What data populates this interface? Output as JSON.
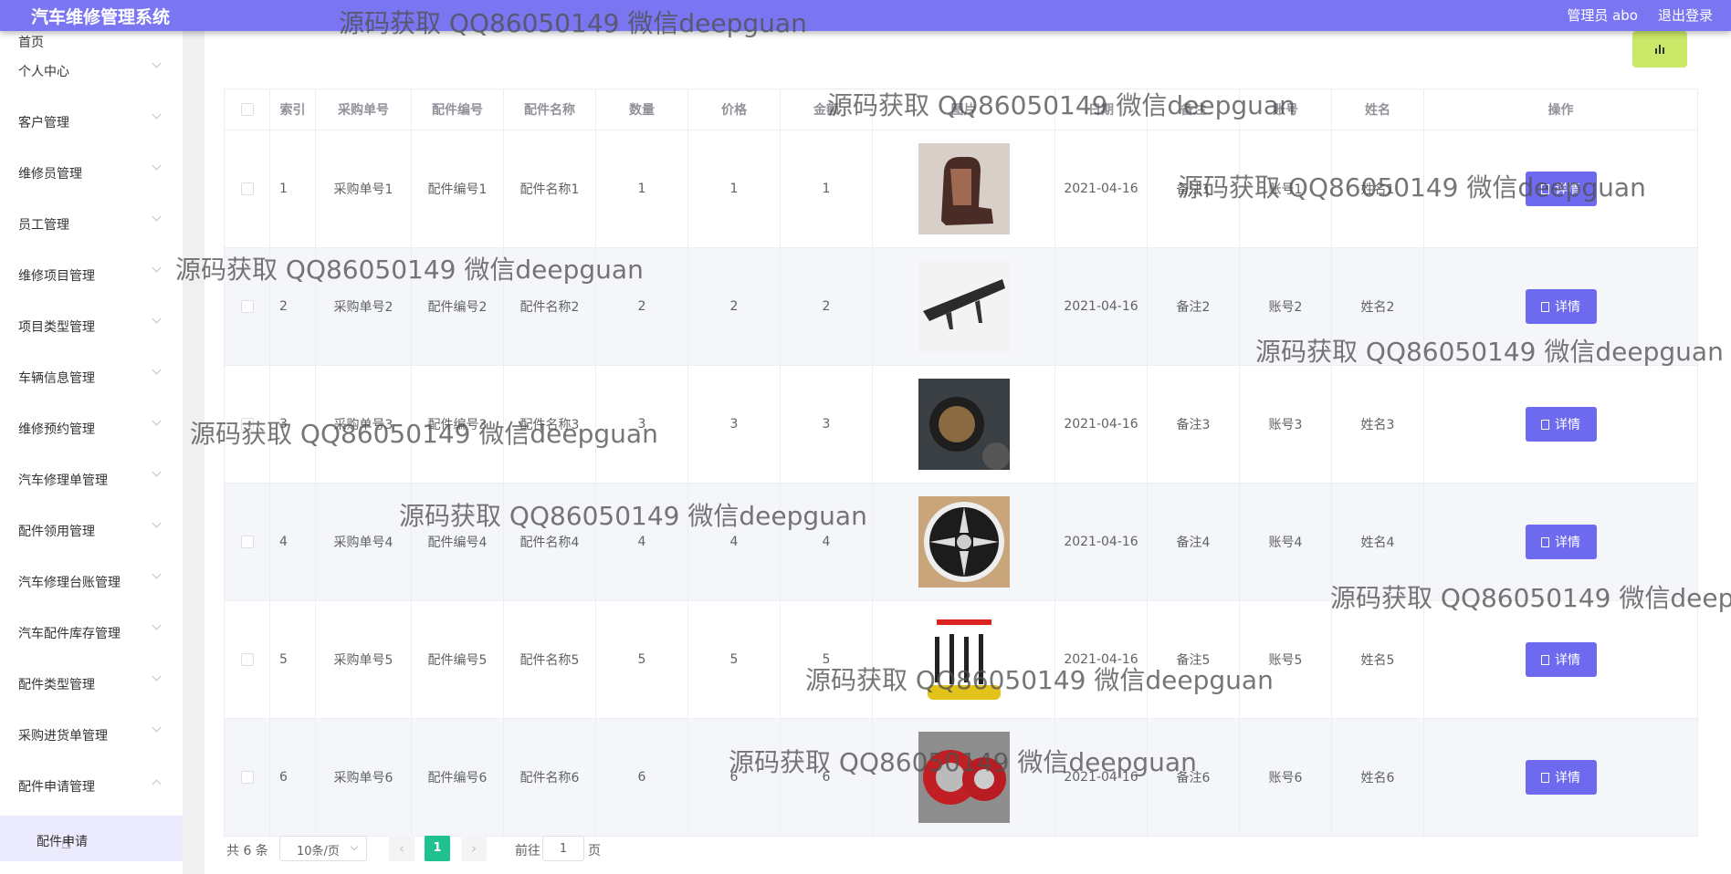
{
  "header": {
    "title": "汽车维修管理系统",
    "user": "管理员 abo",
    "logout": "退出登录"
  },
  "sidebar": {
    "items": [
      {
        "label": "首页"
      },
      {
        "label": "个人中心"
      },
      {
        "label": "客户管理"
      },
      {
        "label": "维修员管理"
      },
      {
        "label": "员工管理"
      },
      {
        "label": "维修项目管理"
      },
      {
        "label": "项目类型管理"
      },
      {
        "label": "车辆信息管理"
      },
      {
        "label": "维修预约管理"
      },
      {
        "label": "汽车修理单管理"
      },
      {
        "label": "配件领用管理"
      },
      {
        "label": "汽车修理台账管理"
      },
      {
        "label": "汽车配件库存管理"
      },
      {
        "label": "配件类型管理"
      },
      {
        "label": "采购进货单管理"
      },
      {
        "label": "配件申请管理"
      }
    ],
    "submenu_label": "配件申请"
  },
  "table": {
    "columns": [
      "索引",
      "采购单号",
      "配件编号",
      "配件名称",
      "数量",
      "价格",
      "金额",
      "图片",
      "日期",
      "备注",
      "账号",
      "姓名",
      "操作"
    ],
    "rows": [
      {
        "index": "1",
        "order_no": "采购单号1",
        "part_no": "配件编号1",
        "part_name": "配件名称1",
        "qty": "1",
        "price": "1",
        "amount": "1",
        "date": "2021-04-16",
        "note": "备注1",
        "account": "账号1",
        "name": "姓名1"
      },
      {
        "index": "2",
        "order_no": "采购单号2",
        "part_no": "配件编号2",
        "part_name": "配件名称2",
        "qty": "2",
        "price": "2",
        "amount": "2",
        "date": "2021-04-16",
        "note": "备注2",
        "account": "账号2",
        "name": "姓名2"
      },
      {
        "index": "3",
        "order_no": "采购单号3",
        "part_no": "配件编号3",
        "part_name": "配件名称3",
        "qty": "3",
        "price": "3",
        "amount": "3",
        "date": "2021-04-16",
        "note": "备注3",
        "account": "账号3",
        "name": "姓名3"
      },
      {
        "index": "4",
        "order_no": "采购单号4",
        "part_no": "配件编号4",
        "part_name": "配件名称4",
        "qty": "4",
        "price": "4",
        "amount": "4",
        "date": "2021-04-16",
        "note": "备注4",
        "account": "账号4",
        "name": "姓名4"
      },
      {
        "index": "5",
        "order_no": "采购单号5",
        "part_no": "配件编号5",
        "part_name": "配件名称5",
        "qty": "5",
        "price": "5",
        "amount": "5",
        "date": "2021-04-16",
        "note": "备注5",
        "account": "账号5",
        "name": "姓名5"
      },
      {
        "index": "6",
        "order_no": "采购单号6",
        "part_no": "配件编号6",
        "part_name": "配件名称6",
        "qty": "6",
        "price": "6",
        "amount": "6",
        "date": "2021-04-16",
        "note": "备注6",
        "account": "账号6",
        "name": "姓名6"
      }
    ],
    "detail_label": "详情"
  },
  "pagination": {
    "total": "共 6 条",
    "page_size": "10条/页",
    "current_page": "1",
    "goto_prefix": "前往",
    "goto_value": "1",
    "goto_suffix": "页"
  },
  "watermark": "源码获取 QQ86050149 微信deepguan",
  "colors": {
    "header": "#7a76f2",
    "button": "#6e6af0",
    "stats_button": "#cbe868",
    "active_page": "#1fc28f"
  }
}
